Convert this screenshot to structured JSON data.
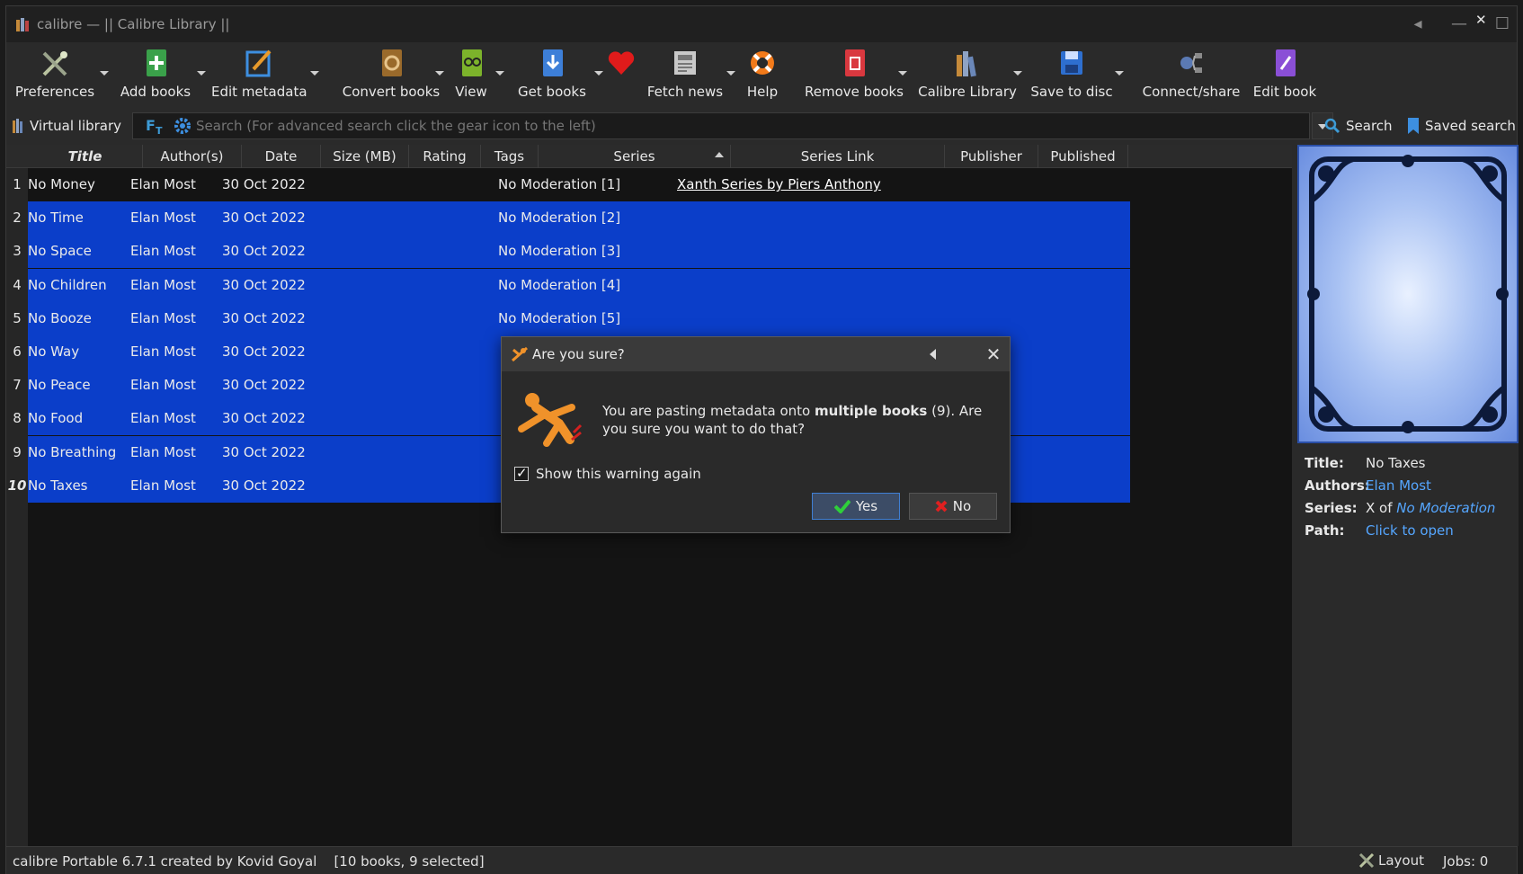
{
  "window": {
    "title": "calibre — || Calibre Library ||"
  },
  "toolbar": {
    "preferences": "Preferences",
    "add_books": "Add books",
    "edit_metadata": "Edit metadata",
    "convert_books": "Convert books",
    "view": "View",
    "get_books": "Get books",
    "fetch_news": "Fetch news",
    "help": "Help",
    "remove_books": "Remove books",
    "calibre_library": "Calibre Library",
    "save_to_disc": "Save to disc",
    "connect_share": "Connect/share",
    "edit_book": "Edit book"
  },
  "searchbar": {
    "virtual_library": "Virtual library",
    "placeholder": "Search (For advanced search click the gear icon to the left)",
    "search": "Search",
    "saved_search": "Saved search"
  },
  "columns": {
    "title": "Title",
    "authors": "Author(s)",
    "date": "Date",
    "size": "Size (MB)",
    "rating": "Rating",
    "tags": "Tags",
    "series": "Series",
    "series_link": "Series Link",
    "publisher": "Publisher",
    "published": "Published"
  },
  "books": [
    {
      "num": "1",
      "title": "No Money",
      "author": "Elan Most",
      "date": "30 Oct 2022",
      "series": "No Moderation [1]",
      "series_link": "Xanth Series by Piers Anthony"
    },
    {
      "num": "2",
      "title": "No Time",
      "author": "Elan Most",
      "date": "30 Oct 2022",
      "series": "No Moderation [2]",
      "series_link": ""
    },
    {
      "num": "3",
      "title": "No Space",
      "author": "Elan Most",
      "date": "30 Oct 2022",
      "series": "No Moderation [3]",
      "series_link": ""
    },
    {
      "num": "4",
      "title": "No Children",
      "author": "Elan Most",
      "date": "30 Oct 2022",
      "series": "No Moderation [4]",
      "series_link": ""
    },
    {
      "num": "5",
      "title": "No Booze",
      "author": "Elan Most",
      "date": "30 Oct 2022",
      "series": "No Moderation [5]",
      "series_link": ""
    },
    {
      "num": "6",
      "title": "No Way",
      "author": "Elan Most",
      "date": "30 Oct 2022",
      "series": "",
      "series_link": ""
    },
    {
      "num": "7",
      "title": "No Peace",
      "author": "Elan Most",
      "date": "30 Oct 2022",
      "series": "",
      "series_link": ""
    },
    {
      "num": "8",
      "title": "No Food",
      "author": "Elan Most",
      "date": "30 Oct 2022",
      "series": "",
      "series_link": ""
    },
    {
      "num": "9",
      "title": "No Breathing",
      "author": "Elan Most",
      "date": "30 Oct 2022",
      "series": "",
      "series_link": ""
    },
    {
      "num": "10",
      "title": "No Taxes",
      "author": "Elan Most",
      "date": "30 Oct 2022",
      "series": "",
      "series_link": ""
    }
  ],
  "details": {
    "title_label": "Title:",
    "title_value": "No Taxes",
    "authors_label": "Authors:",
    "authors_value": "Elan Most",
    "series_label": "Series:",
    "series_prefix": "X of",
    "series_value": "No Moderation",
    "path_label": "Path:",
    "path_value": "Click to open"
  },
  "dialog": {
    "title": "Are you sure?",
    "msg_pre": "You are pasting metadata onto",
    "msg_bold": "multiple books",
    "msg_post": "(9). Are you sure you want to do that?",
    "checkbox_label": "Show this warning again",
    "yes": "Yes",
    "no": "No"
  },
  "status": {
    "text": "calibre Portable 6.7.1 created by Kovid Goyal    [10 books, 9 selected]",
    "layout": "Layout",
    "jobs": "Jobs: 0"
  },
  "colors": {
    "selection": "#0b3ec9",
    "link": "#55a6ff",
    "accent": "#3f7fd4"
  }
}
